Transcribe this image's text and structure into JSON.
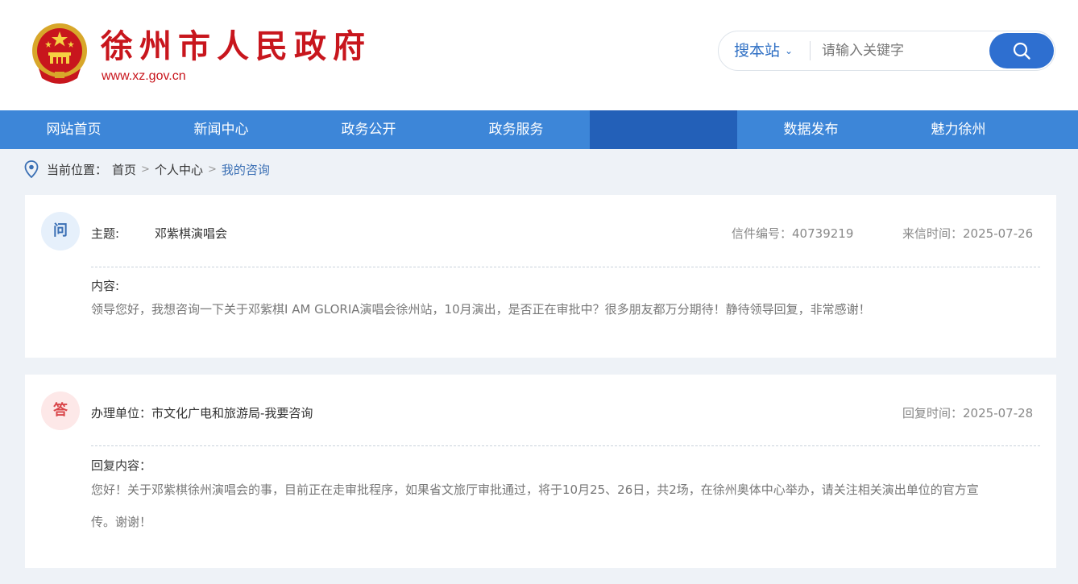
{
  "header": {
    "site_title": "徐州市人民政府",
    "site_url": "www.xz.gov.cn",
    "emblem_icon": "national-emblem-icon",
    "search": {
      "scope_label": "搜本站",
      "placeholder": "请输入关键字",
      "value": ""
    }
  },
  "nav": {
    "items": [
      {
        "label": "网站首页"
      },
      {
        "label": "新闻中心"
      },
      {
        "label": "政务公开"
      },
      {
        "label": "政务服务"
      },
      {
        "label": ""
      },
      {
        "label": "数据发布"
      },
      {
        "label": "魅力徐州"
      }
    ],
    "active_index": 4
  },
  "breadcrumb": {
    "prefix": "当前位置：",
    "items": [
      "首页",
      "个人中心",
      "我的咨询"
    ],
    "separator": ">"
  },
  "question": {
    "badge": "问",
    "subject_label": "主题:",
    "subject": "邓紫棋演唱会",
    "letter_no_label": "信件编号：",
    "letter_no": "40739219",
    "date_label": "来信时间：",
    "date": "2025-07-26",
    "content_label": "内容:",
    "content": "领导您好，我想咨询一下关于邓紫棋I AM GLORIA演唱会徐州站，10月演出，是否正在审批中？很多朋友都万分期待！静待领导回复，非常感谢！"
  },
  "answer": {
    "badge": "答",
    "unit_label": "办理单位：",
    "unit": "市文化广电和旅游局-我要咨询",
    "date_label": "回复时间：",
    "date": "2025-07-28",
    "content_label": "回复内容：",
    "content_line1": "您好！关于邓紫棋徐州演唱会的事，目前正在走审批程序，如果省文旅厅审批通过，将于10月25、26日，共2场，在徐州奥体中心举办，请关注相关演出单位的官方宣",
    "content_line2": "传。谢谢！"
  },
  "colors": {
    "brand_red": "#c8161d",
    "nav_blue": "#3d86d8",
    "nav_active": "#2360b8",
    "accent_blue": "#2e6fd0",
    "page_bg": "#eef2f7"
  }
}
